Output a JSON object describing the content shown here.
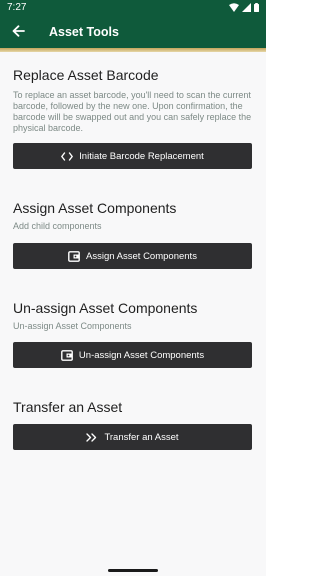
{
  "status_bar": {
    "time": "7:27",
    "icons": [
      "wifi-icon",
      "signal-icon",
      "battery-icon"
    ]
  },
  "app_bar": {
    "title": "Asset Tools",
    "back_icon": "arrow-left-icon"
  },
  "colors": {
    "app_bar": "#0f5a3b",
    "accent_stripe": "#c4a45a",
    "button": "#2f2f31",
    "description": "#7d8a86",
    "background": "#f8f8f9"
  },
  "sections": {
    "replace_barcode": {
      "title": "Replace Asset Barcode",
      "description": "To replace an asset barcode, you'll need to scan the current barcode, followed by the new one. Upon confirmation, the barcode will be swapped out and you can safely replace the physical barcode.",
      "button_label": "Initiate Barcode Replacement",
      "button_icon": "code-brackets-icon"
    },
    "assign_components": {
      "title": "Assign Asset Components",
      "description": "Add child components",
      "button_label": "Assign Asset Components",
      "button_icon": "wallet-icon"
    },
    "unassign_components": {
      "title": "Un-assign Asset Components",
      "description": "Un-assign Asset Components",
      "button_label": "Un-assign Asset Components",
      "button_icon": "wallet-icon"
    },
    "transfer_asset": {
      "title": "Transfer an Asset",
      "button_label": "Transfer an Asset",
      "button_icon": "double-chevron-right-icon"
    }
  }
}
